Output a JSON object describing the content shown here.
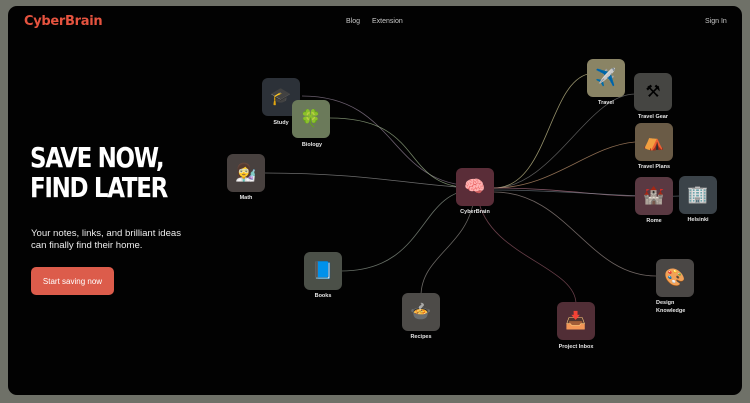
{
  "header": {
    "logo": "CyberBrain",
    "nav": {
      "blog": "Blog",
      "extension": "Extension",
      "sign_in": "Sign In"
    }
  },
  "hero": {
    "title_line1": "SAVE NOW,",
    "title_line2": "FIND LATER",
    "subtitle": "Your notes, links, and brilliant ideas can finally find their home.",
    "cta_label": "Start saving now"
  },
  "colors": {
    "brand": "#e5533f",
    "cta": "#dc5c4b",
    "center_node": "#5a2d38"
  },
  "graph": {
    "center": {
      "label": "CyberBrain",
      "icon": "brain-icon"
    },
    "nodes": [
      {
        "label": "Study",
        "icon": "graduation-cap-icon"
      },
      {
        "label": "Biology",
        "icon": "clover-icon"
      },
      {
        "label": "Math",
        "icon": "scientist-icon"
      },
      {
        "label": "Books",
        "icon": "book-icon"
      },
      {
        "label": "Recipes",
        "icon": "bowl-icon"
      },
      {
        "label": "Project Inbox",
        "icon": "inbox-tray-icon"
      },
      {
        "label": "Travel",
        "icon": "airplane-icon"
      },
      {
        "label": "Travel Gear",
        "icon": "pick-icon"
      },
      {
        "label": "Travel Plans",
        "icon": "tent-icon"
      },
      {
        "label": "Rome",
        "icon": "castle-icon"
      },
      {
        "label": "Helsinki",
        "icon": "building-icon"
      },
      {
        "label": "Design Knowledge",
        "icon": "palette-icon"
      }
    ]
  }
}
